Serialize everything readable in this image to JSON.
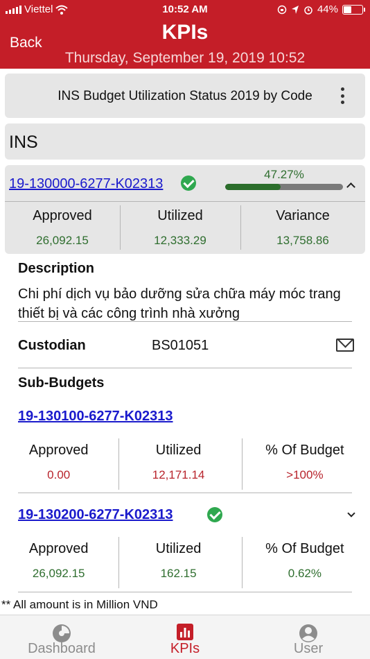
{
  "status_bar": {
    "carrier": "Viettel",
    "time": "10:52 AM",
    "battery": "44%",
    "battery_level": 0.44
  },
  "header": {
    "back_label": "Back",
    "title": "KPIs",
    "subtitle": "Thursday, September 19, 2019 10:52",
    "color": "#c41e28"
  },
  "report": {
    "title": "INS Budget Utilization Status 2019 by Code",
    "section": "INS"
  },
  "budget": {
    "code": "19-130000-6277-K02313",
    "progress_label": "47.27%",
    "progress": 0.4727,
    "approved_label": "Approved",
    "utilized_label": "Utilized",
    "variance_label": "Variance",
    "approved": "26,092.15",
    "utilized": "12,333.29",
    "variance": "13,758.86"
  },
  "description": {
    "label": "Description",
    "text": "Chi phí dịch vụ bảo dưỡng sửa chữa máy móc trang thiết bị và các công trình nhà xưởng"
  },
  "custodian": {
    "label": "Custodian",
    "value": "BS01051"
  },
  "sub_budgets": {
    "label": "Sub-Budgets",
    "items": [
      {
        "code": "19-130100-6277-K02313",
        "approved_label": "Approved",
        "utilized_label": "Utilized",
        "percent_label": "% Of Budget",
        "approved": "0.00",
        "utilized": "12,171.14",
        "percent": ">100%"
      },
      {
        "code": "19-130200-6277-K02313",
        "approved_label": "Approved",
        "utilized_label": "Utilized",
        "percent_label": "% Of Budget",
        "approved": "26,092.15",
        "utilized": "162.15",
        "percent": "0.62%"
      }
    ]
  },
  "footnote": "** All amount is in Million VND",
  "tabs": [
    {
      "label": "Dashboard",
      "icon": "dashboard-icon"
    },
    {
      "label": "KPIs",
      "icon": "kpi-chart-icon"
    },
    {
      "label": "User",
      "icon": "user-icon"
    }
  ]
}
